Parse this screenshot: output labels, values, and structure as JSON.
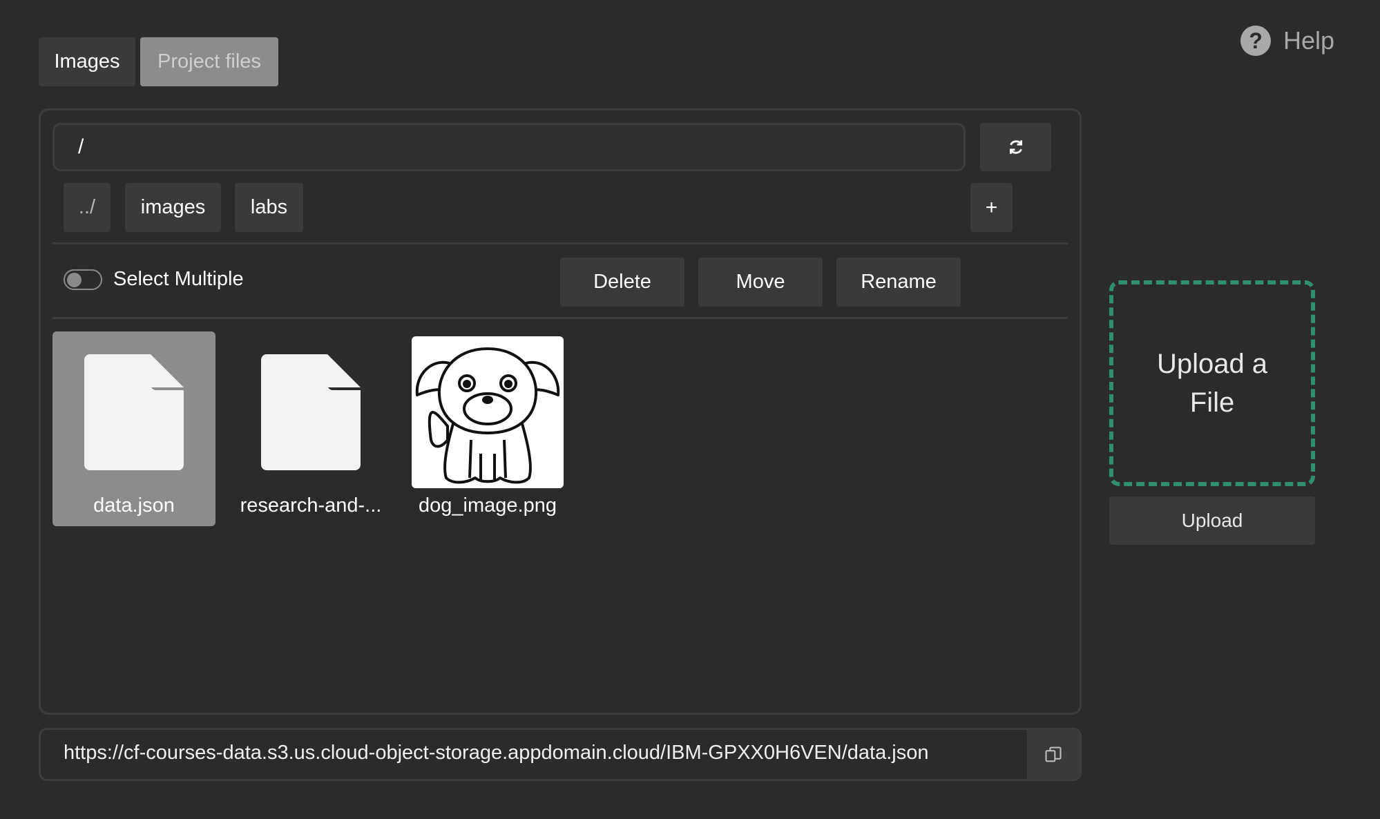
{
  "tabs": [
    {
      "label": "Images",
      "active": false
    },
    {
      "label": "Project files",
      "active": true
    }
  ],
  "help": {
    "label": "Help",
    "icon": "help-circle-icon"
  },
  "path": {
    "value": "/"
  },
  "refresh": {
    "icon": "refresh-icon"
  },
  "breadcrumbs": [
    "../",
    "images",
    "labs"
  ],
  "add_button": {
    "label": "+"
  },
  "select_multiple": {
    "label": "Select Multiple",
    "enabled": false
  },
  "actions": {
    "delete": "Delete",
    "move": "Move",
    "rename": "Rename"
  },
  "files": [
    {
      "name": "data.json",
      "type": "file",
      "icon": "file-icon",
      "selected": true
    },
    {
      "name": "research-and-...",
      "type": "file",
      "icon": "file-icon",
      "selected": false
    },
    {
      "name": "dog_image.png",
      "type": "image",
      "icon": "dog-thumbnail",
      "selected": false
    }
  ],
  "upload": {
    "dropzone_label": "Upload a File",
    "button_label": "Upload"
  },
  "url": {
    "value": "https://cf-courses-data.s3.us.cloud-object-storage.appdomain.cloud/IBM-GPXX0H6VEN/data.json",
    "copy_icon": "copy-icon"
  },
  "colors": {
    "background": "#2b2b2b",
    "button": "#3a3a3a",
    "selected": "#8c8c8c",
    "dropzone_border": "#2f8f6e"
  }
}
